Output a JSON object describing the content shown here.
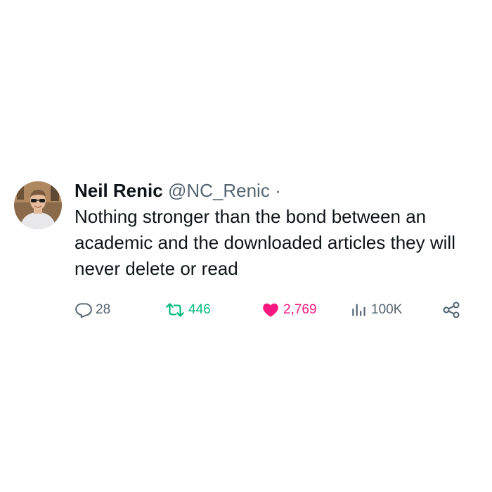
{
  "tweet": {
    "author": {
      "name": "Neil Renic",
      "handle": "@NC_Renic",
      "separator": "·"
    },
    "text": "Nothing stronger than the bond between an academic and the downloaded articles they will never delete or read",
    "actions": {
      "replies": "28",
      "retweets": "446",
      "likes": "2,769",
      "views": "100K"
    }
  },
  "icons": {
    "reply": "reply-icon",
    "retweet": "retweet-icon",
    "like": "heart-icon",
    "views": "views-icon",
    "share": "share-icon"
  },
  "colors": {
    "retweet_active": "#00ba7c",
    "like_active": "#f91880",
    "muted": "#536471",
    "text": "#0f1419"
  }
}
